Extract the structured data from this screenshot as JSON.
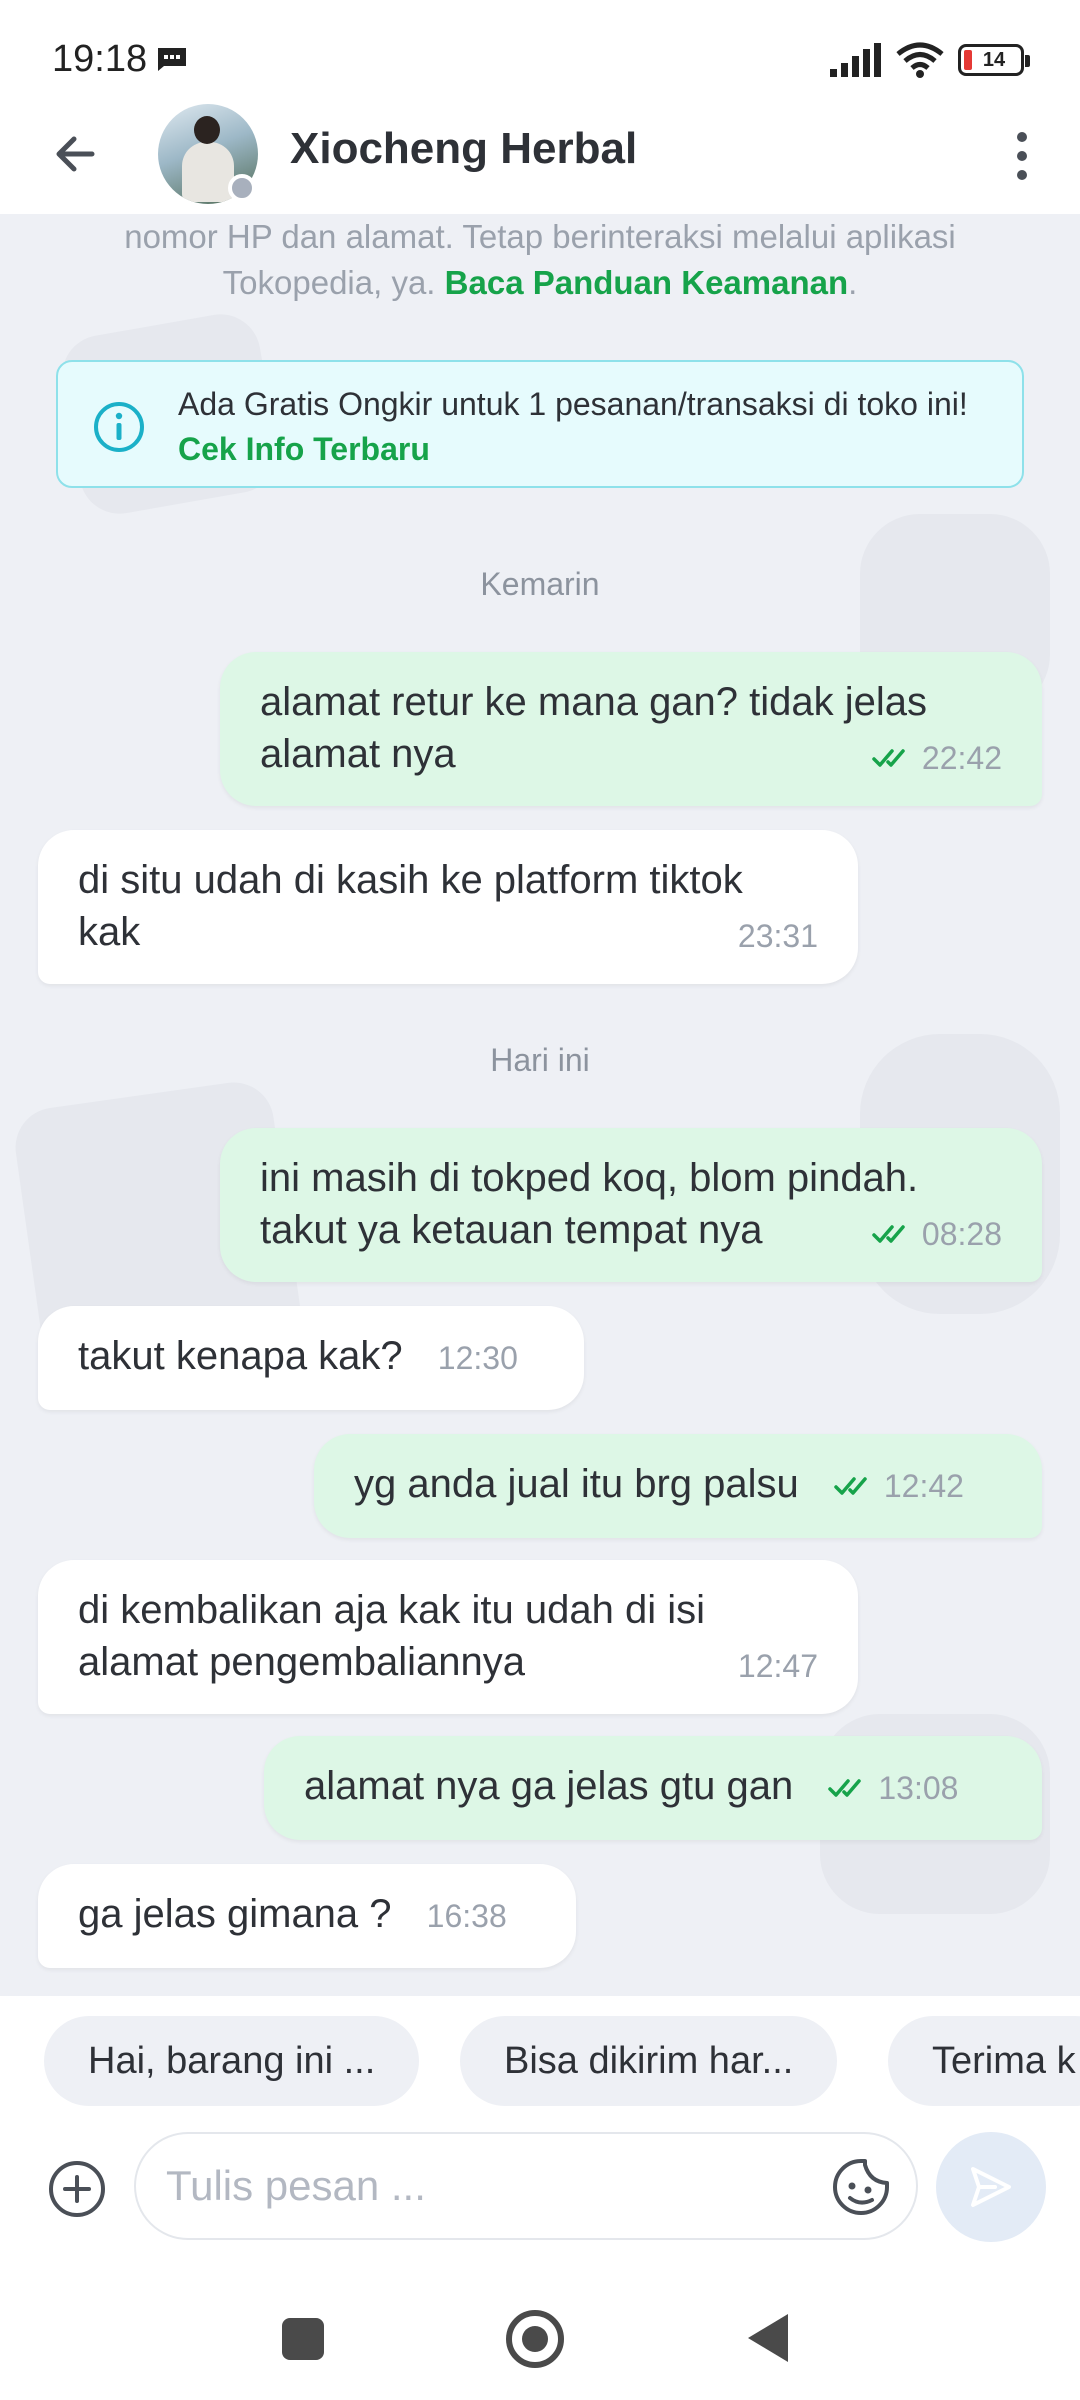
{
  "status_bar": {
    "time": "19:18",
    "battery": "14",
    "icons": [
      "message-icon",
      "signal-icon",
      "wifi-icon",
      "battery-icon"
    ]
  },
  "header": {
    "shop_name": "Xiocheng Herbal",
    "online_status_color": "#a8b0bd"
  },
  "safety_notice": {
    "text_line1": "nomor HP dan alamat. Tetap berinteraksi melalui aplikasi",
    "text_line2": "Tokopedia, ya. ",
    "link": "Baca Panduan Keamanan",
    "suffix": "."
  },
  "promo_banner": {
    "text": "Ada Gratis Ongkir untuk 1 pesanan/transaksi di toko ini! ",
    "link": "Cek Info Terbaru"
  },
  "date_separators": [
    "Kemarin",
    "Hari ini"
  ],
  "messages": [
    {
      "direction": "out",
      "line1": "alamat retur ke mana gan? tidak jelas",
      "line2": "alamat nya",
      "time": "22:42",
      "read": true
    },
    {
      "direction": "in",
      "line1": "di situ udah di kasih ke platform tiktok",
      "line2": "kak",
      "time": "23:31"
    },
    {
      "direction": "out",
      "line1": "ini masih di tokped koq, blom pindah.",
      "line2": "takut ya ketauan tempat nya",
      "time": "08:28",
      "read": true
    },
    {
      "direction": "in",
      "line1": "takut kenapa kak?",
      "time": "12:30"
    },
    {
      "direction": "out",
      "line1": "yg anda jual itu brg palsu",
      "time": "12:42",
      "read": true
    },
    {
      "direction": "in",
      "line1": "di kembalikan aja kak itu udah di isi",
      "line2": "alamat pengembaliannya",
      "time": "12:47"
    },
    {
      "direction": "out",
      "line1": "alamat nya ga jelas gtu gan",
      "time": "13:08",
      "read": true
    },
    {
      "direction": "in",
      "line1": "ga jelas gimana ?",
      "time": "16:38"
    }
  ],
  "quick_replies": [
    "Hai, barang ini ...",
    "Bisa dikirim har...",
    "Terima k"
  ],
  "composer": {
    "placeholder": "Tulis pesan ..."
  },
  "colors": {
    "accent_green": "#16a34a",
    "outgoing_bubble": "#ddf7e6",
    "incoming_bubble": "#ffffff",
    "chat_background": "#eef0f5",
    "read_tick": "#16a34a"
  }
}
